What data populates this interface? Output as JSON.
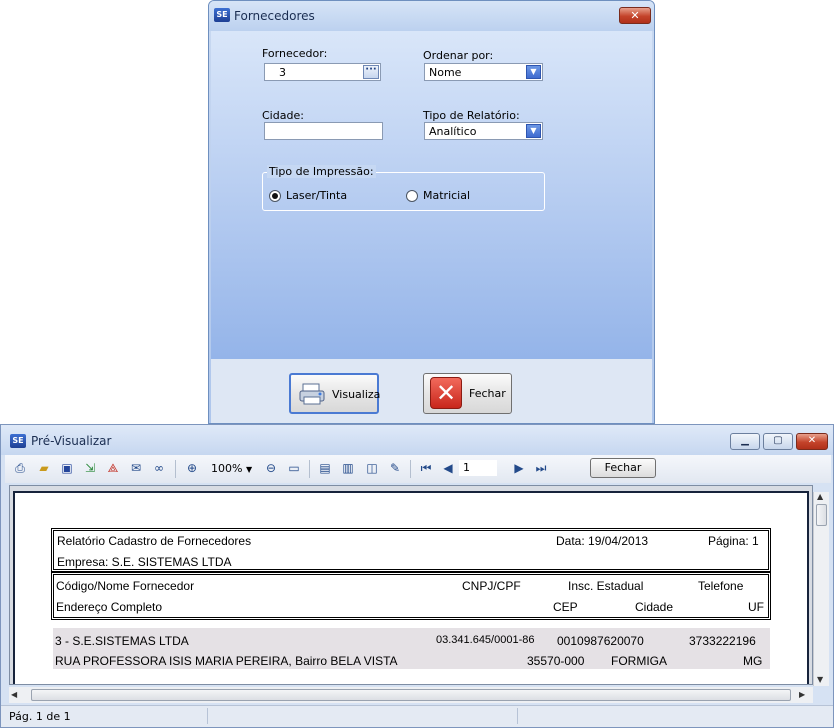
{
  "fornecedores": {
    "title": "Fornecedores",
    "icon_text": "SE",
    "fornecedor_label": "Fornecedor:",
    "fornecedor_value": "3",
    "ordenar_label": "Ordenar por:",
    "ordenar_value": "Nome",
    "cidade_label": "Cidade:",
    "cidade_value": "",
    "tipo_relatorio_label": "Tipo de Relatório:",
    "tipo_relatorio_value": "Analítico",
    "tipo_impressao_label": "Tipo de Impressão:",
    "radio_laser": "Laser/Tinta",
    "radio_matricial": "Matricial",
    "selected_radio": "Laser/Tinta",
    "visualiza_label": "Visualiza",
    "fechar_label": "Fechar",
    "close_glyph": "✕"
  },
  "preview": {
    "title": "Pré-Visualizar",
    "zoom": "100%",
    "page": "1",
    "fechar_label": "Fechar",
    "status": "Pág. 1 de 1",
    "report": {
      "title": "Relatório Cadastro de Fornecedores",
      "date": "Data: 19/04/2013",
      "page": "Página: 1",
      "company": "Empresa: S.E. SISTEMAS LTDA",
      "col_code_name": "Código/Nome Fornecedor",
      "col_cnpj": "CNPJ/CPF",
      "col_insc": "Insc. Estadual",
      "col_telefone": "Telefone",
      "col_endereco": "Endereço Completo",
      "col_cep": "CEP",
      "col_cidade": "Cidade",
      "col_uf": "UF",
      "row": {
        "code_name": "3 - S.E.SISTEMAS LTDA",
        "cnpj": "03.341.645/0001-86",
        "insc": "0010987620070",
        "telefone": "3733222196",
        "endereco": "RUA PROFESSORA ISIS MARIA PEREIRA, Bairro BELA VISTA",
        "cep": "35570-000",
        "cidade": "FORMIGA",
        "uf": "MG"
      }
    }
  }
}
